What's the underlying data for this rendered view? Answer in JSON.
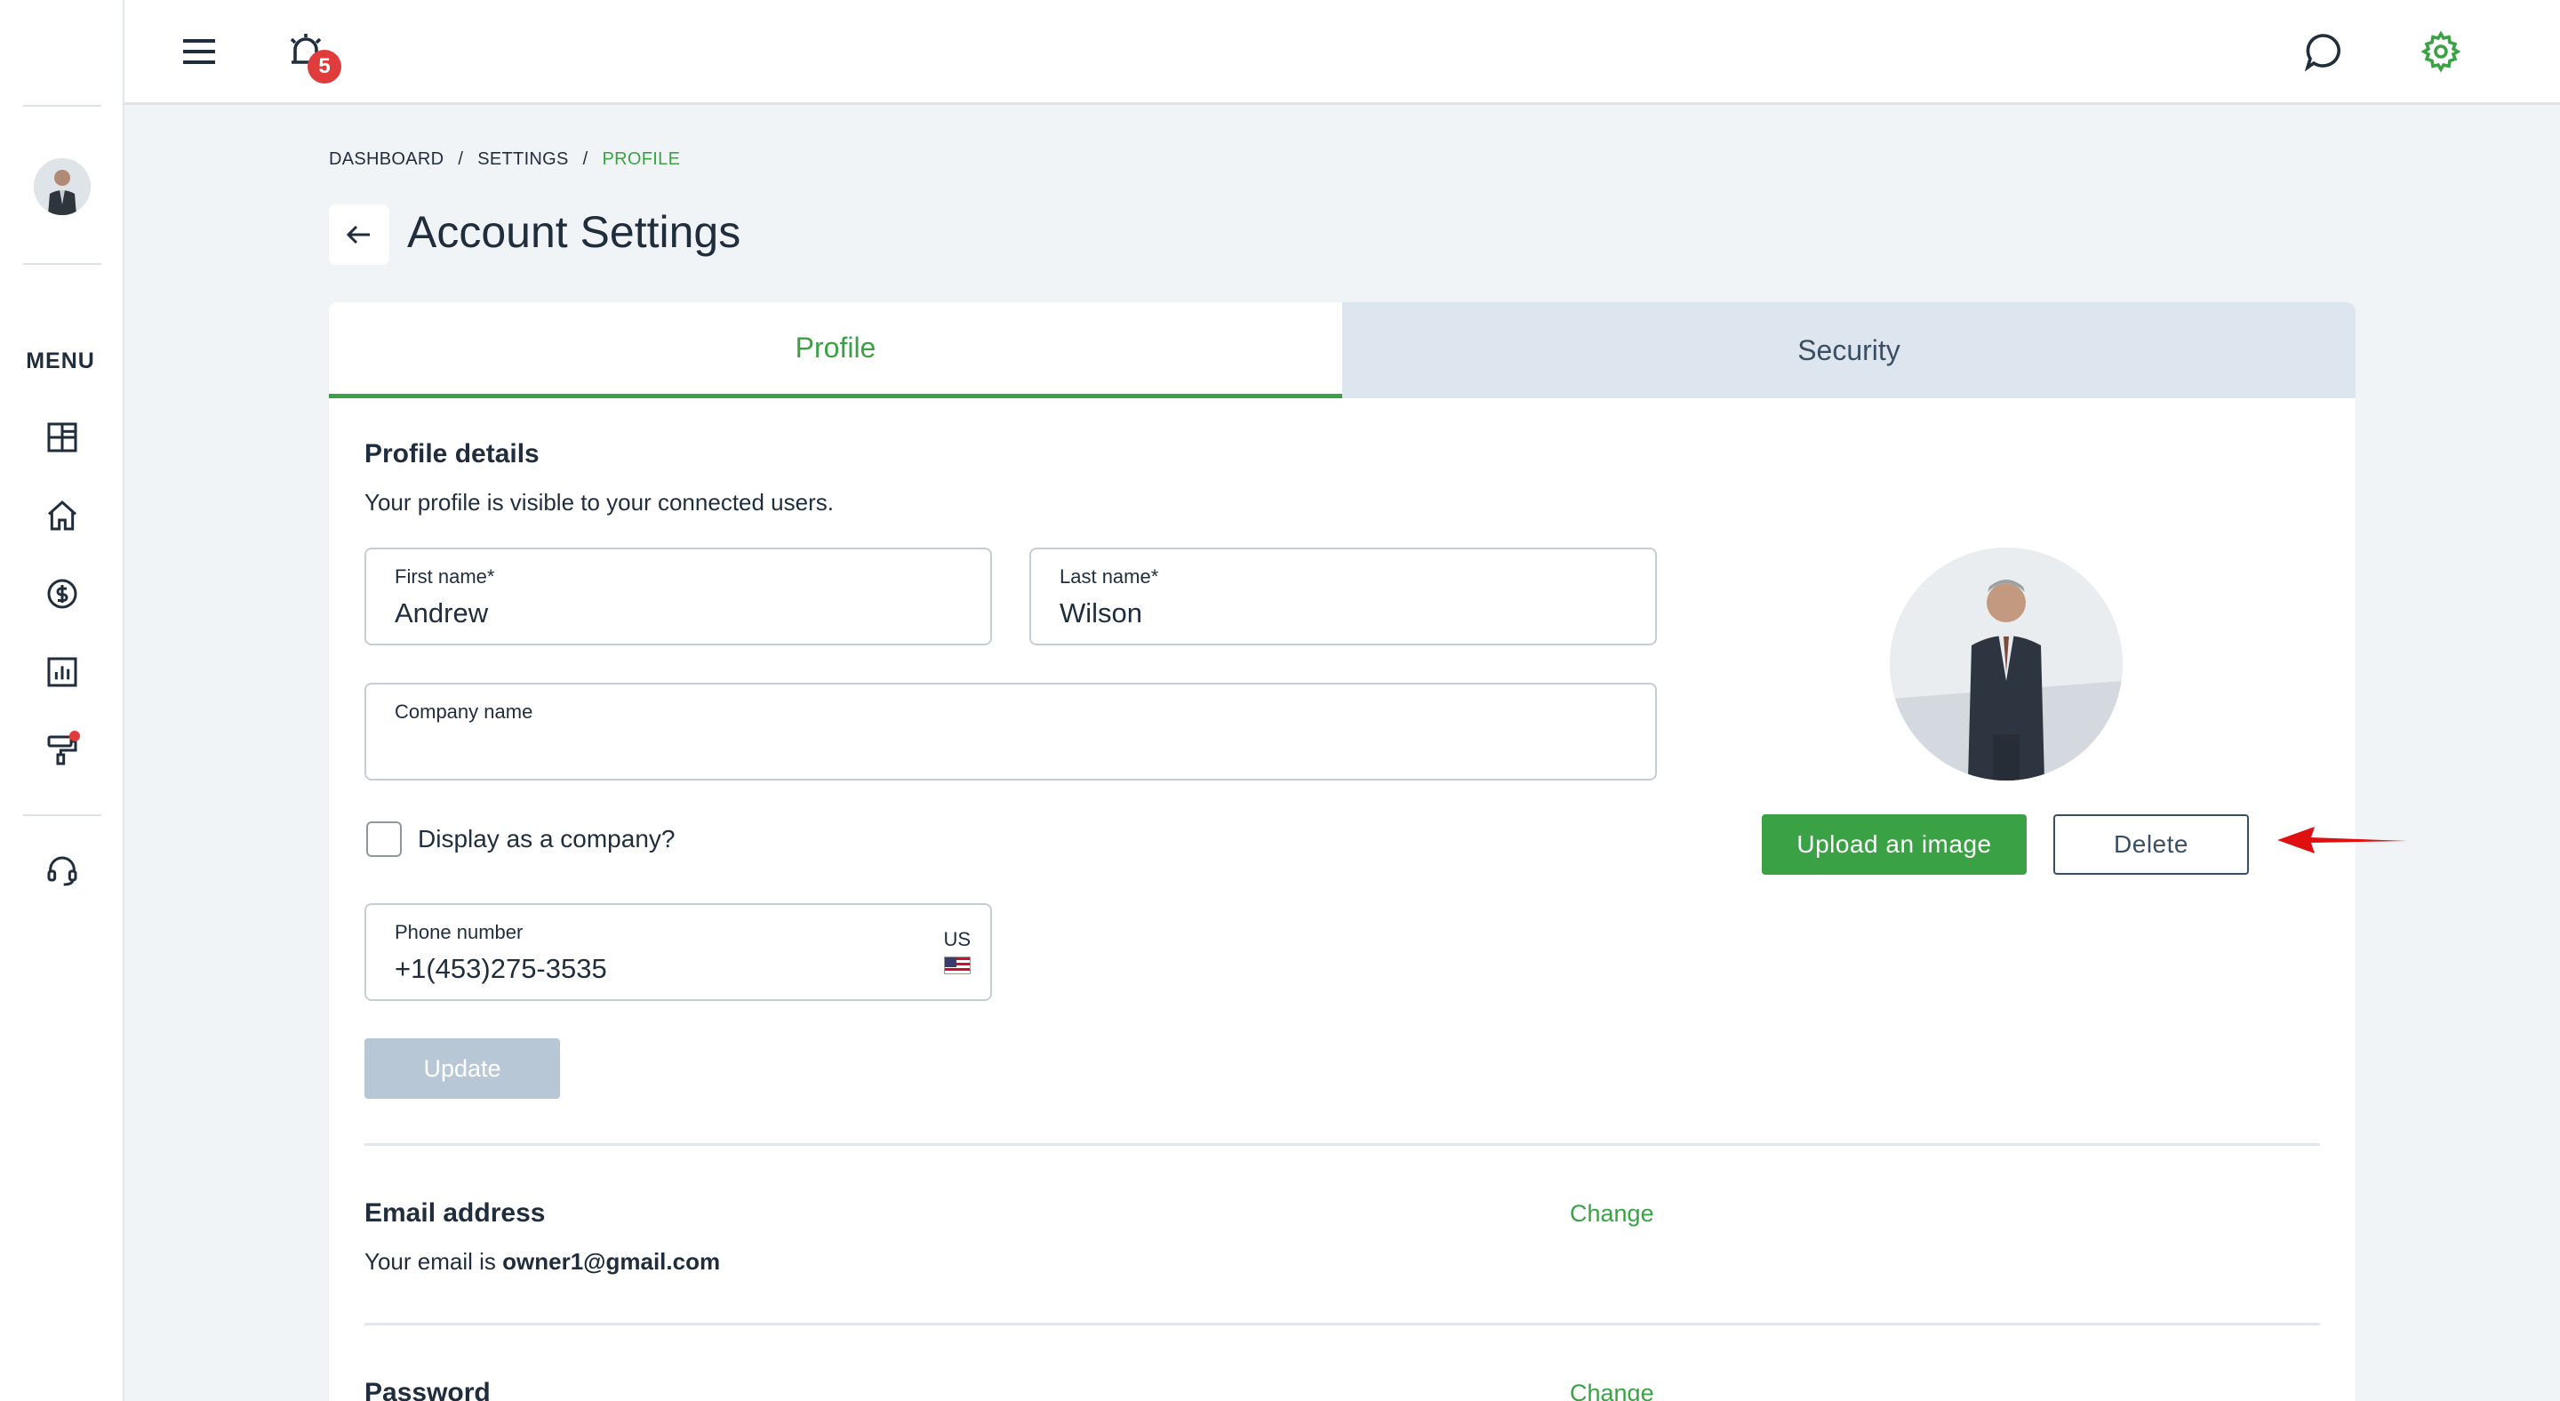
{
  "sidebar": {
    "menu_label": "MENU",
    "items": [
      {
        "icon": "dashboard-icon"
      },
      {
        "icon": "home-icon"
      },
      {
        "icon": "dollar-icon"
      },
      {
        "icon": "bar-chart-icon"
      },
      {
        "icon": "paint-roller-icon",
        "has_notification_dot": true
      },
      {
        "icon": "support-headset-icon"
      }
    ]
  },
  "topbar": {
    "notification_count": "5"
  },
  "breadcrumb": {
    "items": [
      "DASHBOARD",
      "/",
      "SETTINGS",
      "/",
      "PROFILE"
    ]
  },
  "page": {
    "title": "Account Settings"
  },
  "tabs": {
    "profile": "Profile",
    "security": "Security"
  },
  "profile": {
    "title": "Profile details",
    "subtitle": "Your profile is visible to your connected users.",
    "first_name_label": "First name*",
    "first_name_value": "Andrew",
    "last_name_label": "Last name*",
    "last_name_value": "Wilson",
    "company_label": "Company name",
    "company_value": "",
    "display_company_label": "Display as a company?",
    "phone_label": "Phone number",
    "phone_value": "+1(453)275-3535",
    "phone_country": "US",
    "update_label": "Update",
    "upload_label": "Upload an image",
    "delete_label": "Delete"
  },
  "email": {
    "title": "Email address",
    "prefix": "Your email is ",
    "value": "owner1@gmail.com",
    "change_label": "Change"
  },
  "password": {
    "title": "Password",
    "change_label": "Change"
  },
  "colors": {
    "accent": "#3aa244",
    "badge": "#e03c3c",
    "annotation_arrow": "#e01010"
  }
}
